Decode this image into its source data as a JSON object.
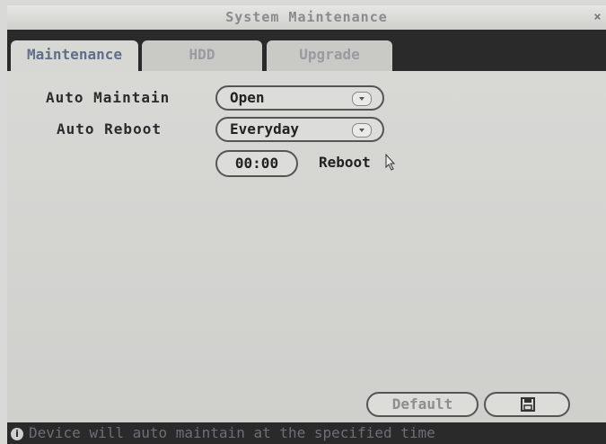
{
  "window": {
    "title": "System Maintenance",
    "close_glyph": "×"
  },
  "tabs": [
    {
      "label": "Maintenance",
      "active": true
    },
    {
      "label": "HDD",
      "active": false
    },
    {
      "label": "Upgrade",
      "active": false
    }
  ],
  "form": {
    "auto_maintain_label": "Auto Maintain",
    "auto_maintain_value": "Open",
    "auto_reboot_label": "Auto Reboot",
    "auto_reboot_value": "Everyday",
    "time_value": "00:00",
    "reboot_label": "Reboot"
  },
  "buttons": {
    "default_label": "Default",
    "save_icon": "save-icon"
  },
  "status": {
    "info_icon": "info-icon",
    "message": "Device will auto maintain at the specified time"
  },
  "colors": {
    "background": "#d9d9d7",
    "bars": "#2a2a2a",
    "active_tab_text": "#5f6f8a"
  }
}
